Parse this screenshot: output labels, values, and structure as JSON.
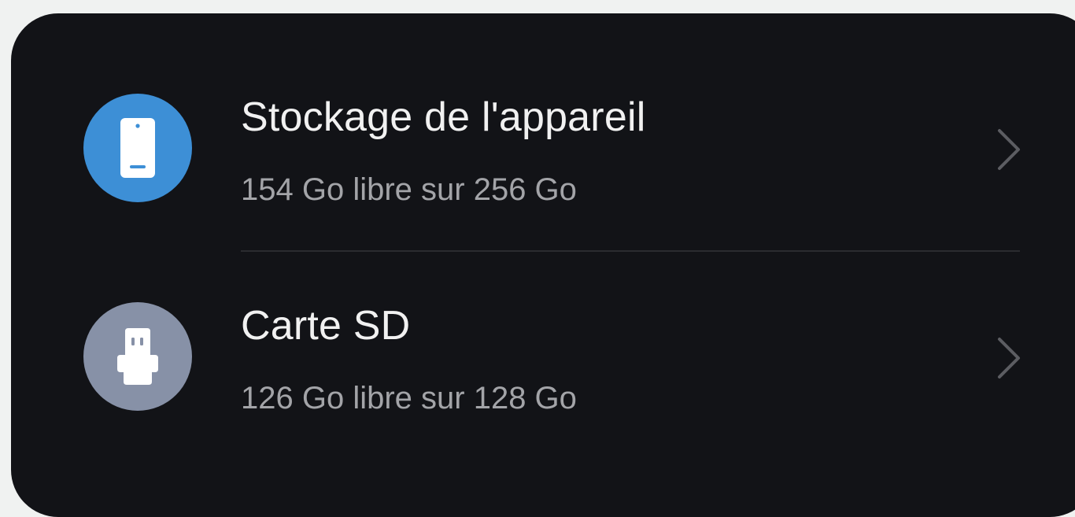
{
  "storage_list": {
    "items": [
      {
        "title": "Stockage de l'appareil",
        "subtitle": "154 Go libre sur 256 Go",
        "icon": "phone-icon",
        "icon_color": "#3d8fd6"
      },
      {
        "title": "Carte SD",
        "subtitle": "126 Go libre sur 128 Go",
        "icon": "sd-card-icon",
        "icon_color": "#8791a7"
      }
    ]
  },
  "colors": {
    "background": "#f0f2f1",
    "card": "#121317",
    "title_text": "#f1f1f1",
    "subtitle_text": "#a3a4a8",
    "chevron": "#5c5d62",
    "divider": "#2b2c30"
  }
}
